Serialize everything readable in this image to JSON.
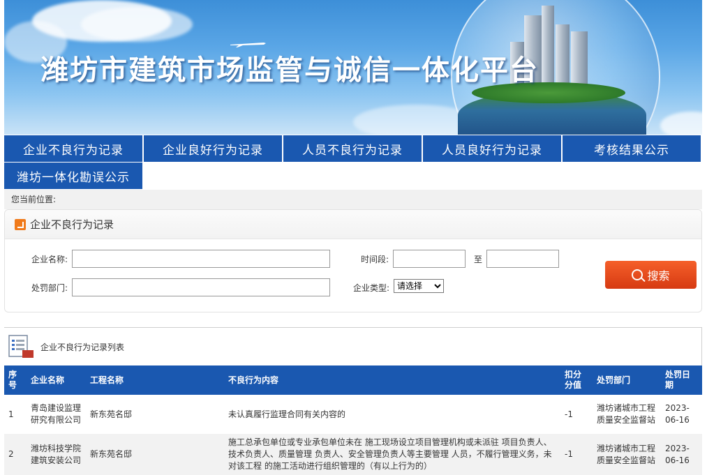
{
  "banner": {
    "title": "潍坊市建筑市场监管与诚信一体化平台"
  },
  "nav": {
    "row1": [
      "企业不良行为记录",
      "企业良好行为记录",
      "人员不良行为记录",
      "人员良好行为记录",
      "考核结果公示"
    ],
    "row2": [
      "潍坊一体化勘误公示"
    ]
  },
  "location": {
    "label": "您当前位置:"
  },
  "search": {
    "title": "企业不良行为记录",
    "company_label": "企业名称:",
    "company_value": "",
    "dept_label": "处罚部门:",
    "dept_value": "",
    "period_label": "时间段:",
    "date_from": "",
    "to_label": "至",
    "date_to": "",
    "type_label": "企业类型:",
    "type_selected": "请选择",
    "button_label": "搜索"
  },
  "list": {
    "title": "企业不良行为记录列表",
    "columns": [
      "序号",
      "企业名称",
      "工程名称",
      "不良行为内容",
      "扣分分值",
      "处罚部门",
      "处罚日期"
    ],
    "rows": [
      {
        "no": "1",
        "company": "青岛建设监理研究有限公司",
        "project": "新东苑名邸",
        "content": "未认真履行监理合同有关内容的",
        "score": "-1",
        "dept": "潍坊诸城市工程质量安全监督站",
        "date": "2023-06-16"
      },
      {
        "no": "2",
        "company": "潍坊科技学院建筑安装公司",
        "project": "新东苑名邸",
        "content": "施工总承包单位或专业承包单位未在 施工现场设立项目管理机构或未派驻 项目负责人、技术负责人、质量管理 负责人、安全管理负责人等主要管理 人员，不履行管理义务，未对该工程 的施工活动进行组织管理的（有以上行为的）",
        "score": "-1",
        "dept": "潍坊诸城市工程质量安全监督站",
        "date": "2023-06-16"
      }
    ]
  },
  "colors": {
    "nav_blue": "#1a58b0",
    "search_orange": "#e8481c",
    "icon_orange": "#f07a1a"
  }
}
